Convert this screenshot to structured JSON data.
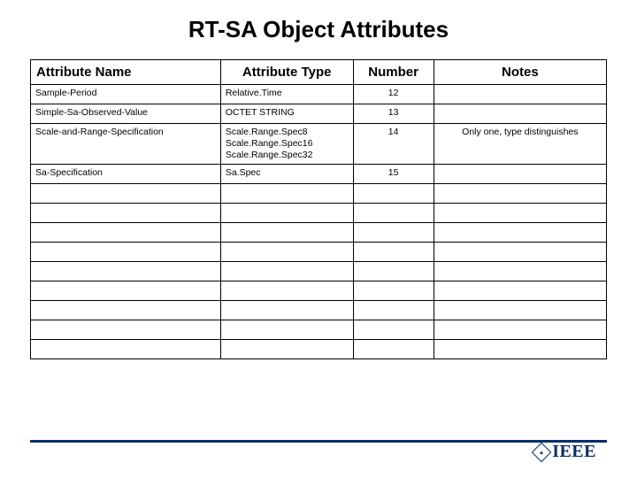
{
  "title": "RT-SA Object Attributes",
  "table": {
    "headers": {
      "name": "Attribute Name",
      "type": "Attribute Type",
      "number": "Number",
      "notes": "Notes"
    },
    "rows": [
      {
        "name": "Sample-Period",
        "type": "Relative.Time",
        "number": "12",
        "notes": ""
      },
      {
        "name": "Simple-Sa-Observed-Value",
        "type": "OCTET STRING",
        "number": "13",
        "notes": ""
      },
      {
        "name": "Scale-and-Range-Specification",
        "type": "Scale.Range.Spec8\nScale.Range.Spec16\nScale.Range.Spec32",
        "number": "14",
        "notes": "Only one, type distinguishes"
      },
      {
        "name": "Sa-Specification",
        "type": "Sa.Spec",
        "number": "15",
        "notes": ""
      },
      {
        "name": "",
        "type": "",
        "number": "",
        "notes": ""
      },
      {
        "name": "",
        "type": "",
        "number": "",
        "notes": ""
      },
      {
        "name": "",
        "type": "",
        "number": "",
        "notes": ""
      },
      {
        "name": "",
        "type": "",
        "number": "",
        "notes": ""
      },
      {
        "name": "",
        "type": "",
        "number": "",
        "notes": ""
      },
      {
        "name": "",
        "type": "",
        "number": "",
        "notes": ""
      },
      {
        "name": "",
        "type": "",
        "number": "",
        "notes": ""
      },
      {
        "name": "",
        "type": "",
        "number": "",
        "notes": ""
      },
      {
        "name": "",
        "type": "",
        "number": "",
        "notes": ""
      }
    ]
  },
  "logo_text": "IEEE"
}
